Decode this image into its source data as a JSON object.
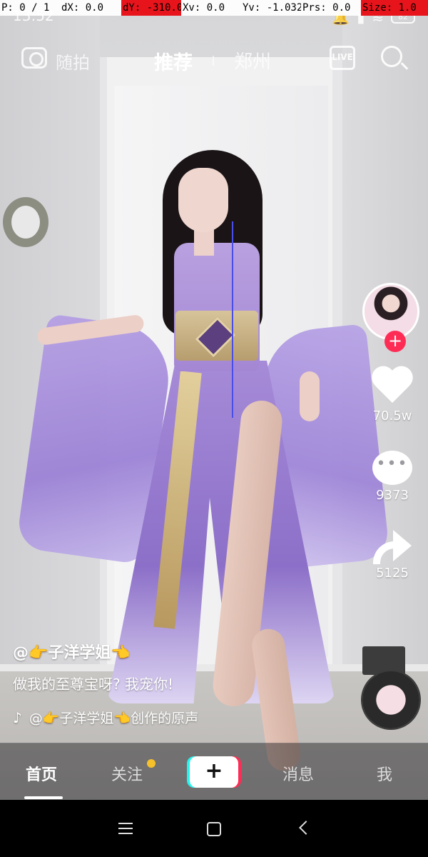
{
  "debug": {
    "pointer": "P: 0 / 1",
    "dx": "dX: 0.0",
    "dy": "dY: -310.0",
    "xv": "Xv: 0.0",
    "yv": "Yv: -1.032",
    "prs": "Prs: 0.0",
    "size": "Size: 1.0"
  },
  "status": {
    "time": "13:52",
    "battery": "82"
  },
  "topnav": {
    "random": "随拍",
    "recommend": "推荐",
    "city": "郑州",
    "live_label": "LIVE"
  },
  "actions": {
    "follow_symbol": "+",
    "likes": "70.5w",
    "comments": "9373",
    "shares": "5125"
  },
  "caption": {
    "author": "@👉子洋学姐👈",
    "description": "做我的至尊宝呀? 我宠你!",
    "music_note": "♪",
    "music": "@👉子洋学姐👈创作的原声"
  },
  "tabs": {
    "home": "首页",
    "follow": "关注",
    "create": "+",
    "messages": "消息",
    "me": "我"
  },
  "colors": {
    "accent": "#fe2c55",
    "cyan": "#25f4ee",
    "badge": "#f7c12b",
    "debug_alert": "#e8141b"
  }
}
